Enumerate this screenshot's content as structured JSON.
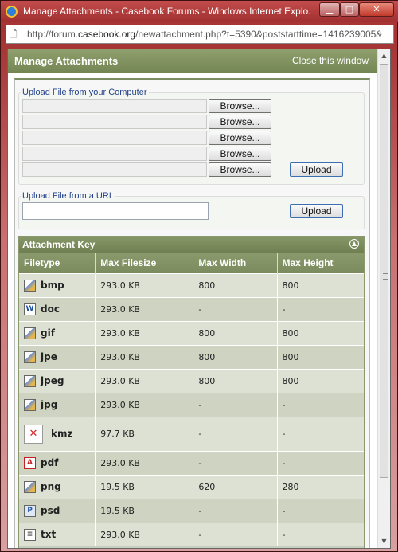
{
  "window": {
    "title": "Manage Attachments - Casebook Forums - Windows Internet Explo...",
    "url_prefix": "http://forum.",
    "url_domain": "casebook.org",
    "url_rest": "/newattachment.php?t=5390&poststarttime=1416239005&"
  },
  "header": {
    "title": "Manage Attachments",
    "close_link": "Close this window"
  },
  "upload_computer": {
    "legend": "Upload File from your Computer",
    "browse_label": "Browse...",
    "upload_label": "Upload",
    "inputs": [
      "",
      "",
      "",
      "",
      ""
    ]
  },
  "upload_url": {
    "legend": "Upload File from a URL",
    "value": "",
    "upload_label": "Upload"
  },
  "attachment_key": {
    "title": "Attachment Key",
    "columns": [
      "Filetype",
      "Max Filesize",
      "Max Width",
      "Max Height"
    ],
    "rows": [
      {
        "icon": "image-file-icon",
        "ext": "bmp",
        "size": "293.0 KB",
        "width": "800",
        "height": "800"
      },
      {
        "icon": "word-document-icon",
        "ext": "doc",
        "size": "293.0 KB",
        "width": "-",
        "height": "-"
      },
      {
        "icon": "image-file-icon",
        "ext": "gif",
        "size": "293.0 KB",
        "width": "800",
        "height": "800"
      },
      {
        "icon": "image-file-icon",
        "ext": "jpe",
        "size": "293.0 KB",
        "width": "800",
        "height": "800"
      },
      {
        "icon": "image-file-icon",
        "ext": "jpeg",
        "size": "293.0 KB",
        "width": "800",
        "height": "800"
      },
      {
        "icon": "image-file-icon",
        "ext": "jpg",
        "size": "293.0 KB",
        "width": "-",
        "height": "-"
      },
      {
        "icon": "broken-image-icon",
        "ext": "kmz",
        "size": "97.7 KB",
        "width": "-",
        "height": "-"
      },
      {
        "icon": "pdf-file-icon",
        "ext": "pdf",
        "size": "293.0 KB",
        "width": "-",
        "height": "-"
      },
      {
        "icon": "image-file-icon",
        "ext": "png",
        "size": "19.5 KB",
        "width": "620",
        "height": "280"
      },
      {
        "icon": "photoshop-file-icon",
        "ext": "psd",
        "size": "19.5 KB",
        "width": "-",
        "height": "-"
      },
      {
        "icon": "text-file-icon",
        "ext": "txt",
        "size": "293.0 KB",
        "width": "-",
        "height": "-"
      }
    ]
  }
}
